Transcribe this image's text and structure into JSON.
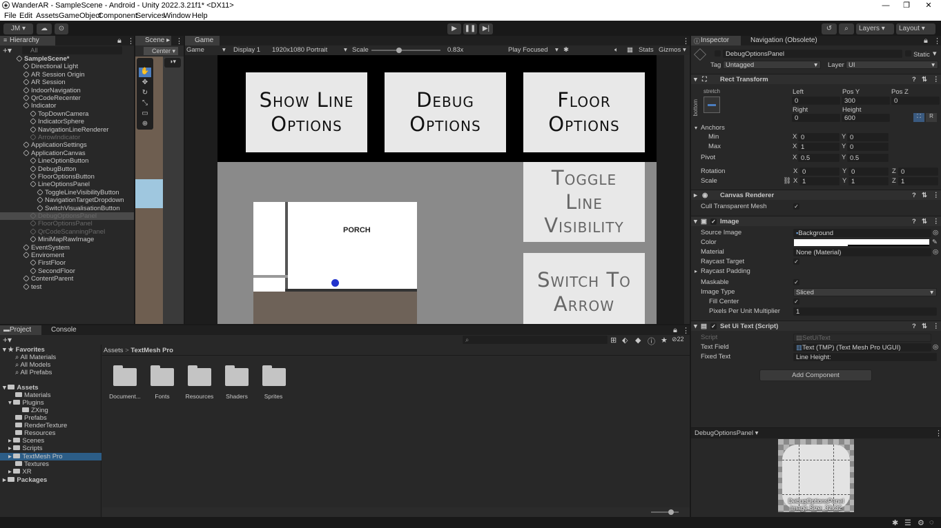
{
  "window": {
    "title": "WanderAR - SampleScene - Android - Unity 2022.3.21f1* <DX11>"
  },
  "menu": [
    "File",
    "Edit",
    "Assets",
    "GameObject",
    "Component",
    "Services",
    "Window",
    "Help"
  ],
  "toolbar": {
    "account": "JM ▾",
    "layers": "Layers",
    "layout": "Layout"
  },
  "hierarchy": {
    "tab": "Hierarchy",
    "search_placeholder": "All",
    "items": [
      {
        "label": "SampleScene*",
        "depth": 0,
        "dim": false,
        "bold": true
      },
      {
        "label": "Directional Light",
        "depth": 1,
        "dim": false
      },
      {
        "label": "AR Session Origin",
        "depth": 1,
        "dim": false
      },
      {
        "label": "AR Session",
        "depth": 1,
        "dim": false
      },
      {
        "label": "IndoorNavigation",
        "depth": 1,
        "dim": false
      },
      {
        "label": "QrCodeRecenter",
        "depth": 1,
        "dim": false
      },
      {
        "label": "Indicator",
        "depth": 1,
        "dim": false
      },
      {
        "label": "TopDownCamera",
        "depth": 2,
        "dim": false
      },
      {
        "label": "IndicatorSphere",
        "depth": 2,
        "dim": false
      },
      {
        "label": "NavigationLineRenderer",
        "depth": 2,
        "dim": false
      },
      {
        "label": "ArrowIndicator",
        "depth": 2,
        "dim": true
      },
      {
        "label": "ApplicationSettings",
        "depth": 1,
        "dim": false
      },
      {
        "label": "ApplicationCanvas",
        "depth": 1,
        "dim": false
      },
      {
        "label": "LineOptionButton",
        "depth": 2,
        "dim": false
      },
      {
        "label": "DebugButton",
        "depth": 2,
        "dim": false
      },
      {
        "label": "FloorOptionsButton",
        "depth": 2,
        "dim": false
      },
      {
        "label": "LineOptionsPanel",
        "depth": 2,
        "dim": false
      },
      {
        "label": "ToggleLineVisibilityButton",
        "depth": 3,
        "dim": false
      },
      {
        "label": "NavigationTargetDropdown",
        "depth": 3,
        "dim": false
      },
      {
        "label": "SwitchVisualisationButton",
        "depth": 3,
        "dim": false
      },
      {
        "label": "DebugOptionsPanel",
        "depth": 2,
        "dim": true,
        "selected": true
      },
      {
        "label": "FloorOptionsPanel",
        "depth": 2,
        "dim": true
      },
      {
        "label": "QrCodeScanningPanel",
        "depth": 2,
        "dim": true
      },
      {
        "label": "MiniMapRawImage",
        "depth": 2,
        "dim": false
      },
      {
        "label": "EventSystem",
        "depth": 1,
        "dim": false
      },
      {
        "label": "Enviroment",
        "depth": 1,
        "dim": false
      },
      {
        "label": "FirstFloor",
        "depth": 2,
        "dim": false
      },
      {
        "label": "SecondFloor",
        "depth": 2,
        "dim": false
      },
      {
        "label": "ContentParent",
        "depth": 1,
        "dim": false
      },
      {
        "label": "test",
        "depth": 1,
        "dim": false
      }
    ]
  },
  "scene": {
    "tab": "Scene",
    "pivot": "Center"
  },
  "game": {
    "tab": "Game",
    "display_mode": "Game",
    "display": "Display 1",
    "resolution": "1920x1080 Portrait",
    "scale_label": "Scale",
    "scale_value": "0.83x",
    "play_mode": "Play Focused",
    "stats": "Stats",
    "gizmos": "Gizmos",
    "buttons": {
      "show_line": "Show Line Options",
      "debug": "Debug Options",
      "floor": "Floor Options",
      "toggle": "Toggle Line Visibility",
      "switch": "Switch To Arrow"
    },
    "map_label": "PORCH"
  },
  "project": {
    "tab": "Project",
    "console_tab": "Console",
    "favorites_label": "Favorites",
    "favorites": [
      "All Materials",
      "All Models",
      "All Prefabs"
    ],
    "assets_label": "Assets",
    "assets": [
      "Materials",
      "Plugins",
      "ZXing",
      "Prefabs",
      "RenderTexture",
      "Resources",
      "Scenes",
      "Scripts",
      "TextMesh Pro",
      "Textures",
      "XR"
    ],
    "packages_label": "Packages",
    "breadcrumb": [
      "Assets",
      "TextMesh Pro"
    ],
    "folders": [
      "Document...",
      "Fonts",
      "Resources",
      "Shaders",
      "Sprites"
    ],
    "hidden_count": "22"
  },
  "inspector": {
    "tab": "Inspector",
    "nav_tab": "Navigation (Obsolete)",
    "object_name": "DebugOptionsPanel",
    "static_label": "Static",
    "tag_label": "Tag",
    "tag": "Untagged",
    "layer_label": "Layer",
    "layer": "UI",
    "rect": {
      "title": "Rect Transform",
      "stretch": "stretch",
      "bottom": "bottom",
      "left_label": "Left",
      "left": "0",
      "posy_label": "Pos Y",
      "posy": "300",
      "posz_label": "Pos Z",
      "posz": "0",
      "right_label": "Right",
      "right": "0",
      "height_label": "Height",
      "height": "600",
      "anchors": "Anchors",
      "min": "Min",
      "max": "Max",
      "pivot": "Pivot",
      "min_x": "0",
      "min_y": "0",
      "max_x": "1",
      "max_y": "0",
      "pivot_x": "0.5",
      "pivot_y": "0.5",
      "rotation": "Rotation",
      "rot_x": "0",
      "rot_y": "0",
      "rot_z": "0",
      "scale": "Scale",
      "scale_x": "1",
      "scale_y": "1",
      "scale_z": "1"
    },
    "canvas_renderer": {
      "title": "Canvas Renderer",
      "cull": "Cull Transparent Mesh"
    },
    "image": {
      "title": "Image",
      "source_label": "Source Image",
      "source": "Background",
      "color_label": "Color",
      "material_label": "Material",
      "material": "None (Material)",
      "raycast_target": "Raycast Target",
      "raycast_padding": "Raycast Padding",
      "maskable": "Maskable",
      "image_type_label": "Image Type",
      "image_type": "Sliced",
      "fill_center": "Fill Center",
      "ppu_label": "Pixels Per Unit Multiplier",
      "ppu": "1"
    },
    "setui": {
      "title": "Set Ui Text (Script)",
      "script_label": "Script",
      "script": "SetUiText",
      "text_field_label": "Text Field",
      "text_field": "Text (TMP) (Text Mesh Pro UGUI)",
      "fixed_text_label": "Fixed Text",
      "fixed_text": "Line Height:"
    },
    "add_component": "Add Component",
    "preview_title": "DebugOptionsPanel ▾",
    "preview_name": "DebugOptionsPanel",
    "preview_size": "Image Size: 32x32"
  }
}
